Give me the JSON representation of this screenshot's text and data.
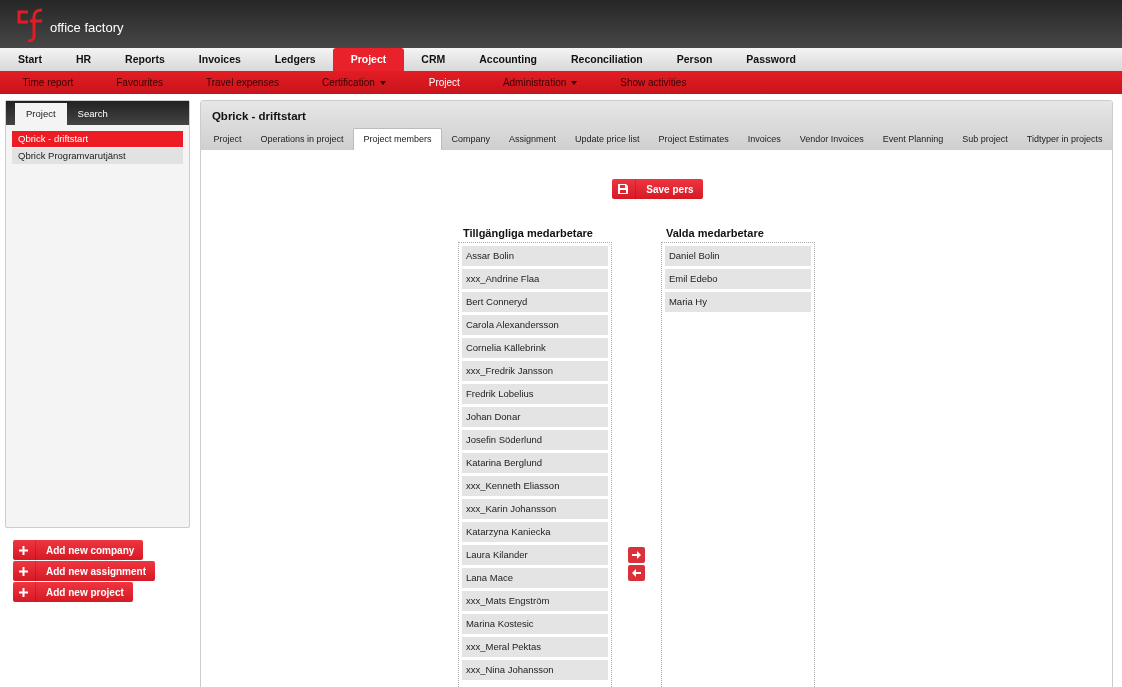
{
  "header": {
    "logo_text": "office factory"
  },
  "main_nav": [
    {
      "label": "Start",
      "selected": false
    },
    {
      "label": "HR",
      "selected": false
    },
    {
      "label": "Reports",
      "selected": false
    },
    {
      "label": "Invoices",
      "selected": false
    },
    {
      "label": "Ledgers",
      "selected": false
    },
    {
      "label": "Project",
      "selected": true
    },
    {
      "label": "CRM",
      "selected": false
    },
    {
      "label": "Accounting",
      "selected": false
    },
    {
      "label": "Reconciliation",
      "selected": false
    },
    {
      "label": "Person",
      "selected": false
    },
    {
      "label": "Password",
      "selected": false
    }
  ],
  "sub_nav": [
    {
      "label": "Time report",
      "selected": false,
      "dropdown": false
    },
    {
      "label": "Favourites",
      "selected": false,
      "dropdown": false
    },
    {
      "label": "Travel expenses",
      "selected": false,
      "dropdown": false
    },
    {
      "label": "Certification",
      "selected": false,
      "dropdown": true
    },
    {
      "label": "Project",
      "selected": true,
      "dropdown": false
    },
    {
      "label": "Administration",
      "selected": false,
      "dropdown": true
    },
    {
      "label": "Show activities",
      "selected": false,
      "dropdown": false
    }
  ],
  "sidebar": {
    "tabs": [
      {
        "label": "Project",
        "selected": true
      },
      {
        "label": "Search",
        "selected": false
      }
    ],
    "items": [
      {
        "label": "Qbrick - driftstart",
        "selected": true
      },
      {
        "label": "Qbrick Programvarutjänst",
        "selected": false
      }
    ],
    "buttons": [
      "Add new company",
      "Add new assignment",
      "Add new project"
    ]
  },
  "panel": {
    "title": "Qbrick - driftstart",
    "tabs": [
      {
        "label": "Project",
        "selected": false
      },
      {
        "label": "Operations in project",
        "selected": false
      },
      {
        "label": "Project members",
        "selected": true
      },
      {
        "label": "Company",
        "selected": false
      },
      {
        "label": "Assignment",
        "selected": false
      },
      {
        "label": "Update price list",
        "selected": false
      },
      {
        "label": "Project Estimates",
        "selected": false
      },
      {
        "label": "Invoices",
        "selected": false
      },
      {
        "label": "Vendor Invoices",
        "selected": false
      },
      {
        "label": "Event Planning",
        "selected": false
      },
      {
        "label": "Sub project",
        "selected": false
      },
      {
        "label": "Tidtyper in projects",
        "selected": false
      }
    ],
    "save_button": "Save pers",
    "available": {
      "heading": "Tillgängliga medarbetare",
      "items": [
        "Assar Bolin",
        "xxx_Andrine Flaa",
        "Bert Conneryd",
        "Carola Alexandersson",
        "Cornelia Källebrink",
        "xxx_Fredrik Jansson",
        "Fredrik Lobelius",
        "Johan Donar",
        "Josefin Söderlund",
        "Katarina Berglund",
        "xxx_Kenneth Eliasson",
        "xxx_Karin Johansson",
        "Katarzyna Kaniecka",
        "Laura Kilander",
        "Lana Mace",
        "xxx_Mats Engström",
        "Marina Kostesic",
        "xxx_Meral Pektas",
        "xxx_Nina Johansson"
      ]
    },
    "selected": {
      "heading": "Valda medarbetare",
      "items": [
        "Daniel Bolin",
        "Emil Edebo",
        "Maria Hy"
      ]
    }
  }
}
